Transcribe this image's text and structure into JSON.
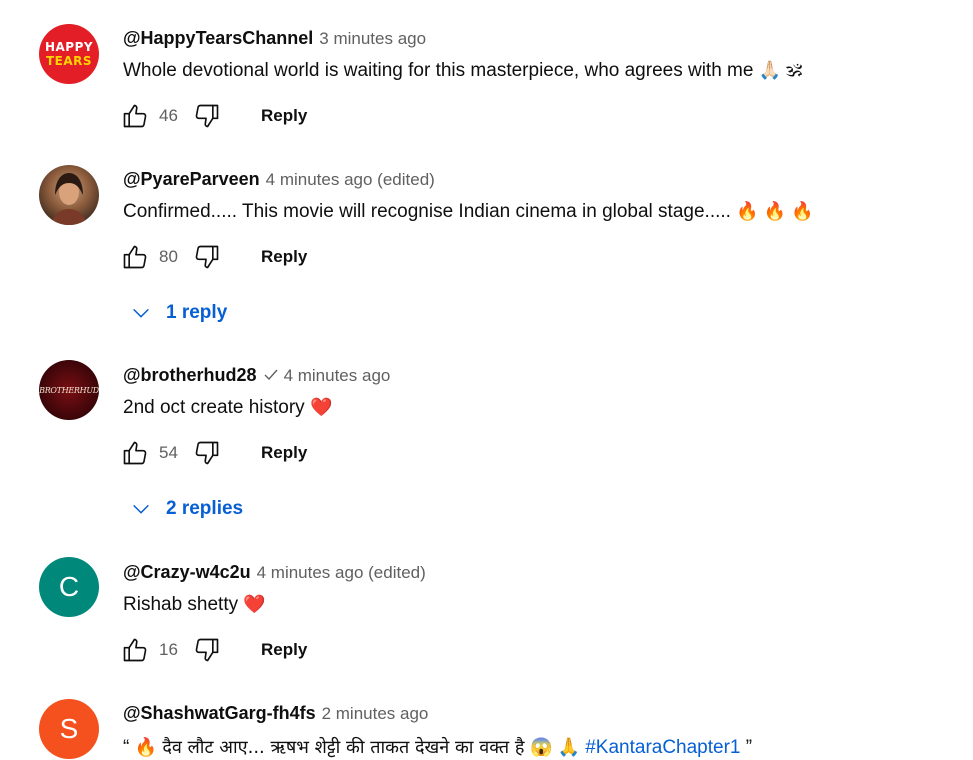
{
  "comments": [
    {
      "author": "@HappyTearsChannel",
      "time": "3 minutes ago",
      "text": "Whole devotional world is waiting for this masterpiece, who agrees with me",
      "emojis": "🙏🏻 🕉",
      "likes": "46",
      "reply_label": "Reply",
      "avatar_text_1": "HAPPY",
      "avatar_text_2": "TEARS"
    },
    {
      "author": "@PyareParveen",
      "time": "4 minutes ago (edited)",
      "text": "Confirmed..... This movie will recognise Indian cinema in global stage.....",
      "emojis": "🔥 🔥 🔥",
      "likes": "80",
      "reply_label": "Reply",
      "replies_label": "1 reply"
    },
    {
      "author": "@brotherhud28",
      "verified_icon": "check-icon",
      "time": "4 minutes ago",
      "text": "2nd oct create history",
      "emojis": "❤️",
      "likes": "54",
      "reply_label": "Reply",
      "replies_label": "2 replies",
      "avatar_text": "BROTHERHUD"
    },
    {
      "author": "@Crazy-w4c2u",
      "time": "4 minutes ago (edited)",
      "text": "Rishab shetty",
      "emojis": "❤️",
      "likes": "16",
      "reply_label": "Reply",
      "avatar_letter": "C",
      "avatar_color": "#00897b"
    },
    {
      "author": "@ShashwatGarg-fh4fs",
      "time": "2 minutes ago",
      "text_open": "“",
      "emoji_1": "🔥",
      "text": " दैव लौट आए... ऋषभ शेट्टी की ताकत देखने का वक्त है ",
      "emoji_2": "😱 🙏",
      "hashtag": "#KantaraChapter1",
      "text_close": "”",
      "avatar_letter": "S",
      "avatar_color": "#f4511e"
    }
  ],
  "colors": {
    "link": "#065fd4",
    "secondary_text": "#606060",
    "primary_text": "#0f0f0f"
  },
  "icons": {
    "like": "thumbs-up-icon",
    "dislike": "thumbs-down-icon",
    "expand": "chevron-down-icon"
  }
}
